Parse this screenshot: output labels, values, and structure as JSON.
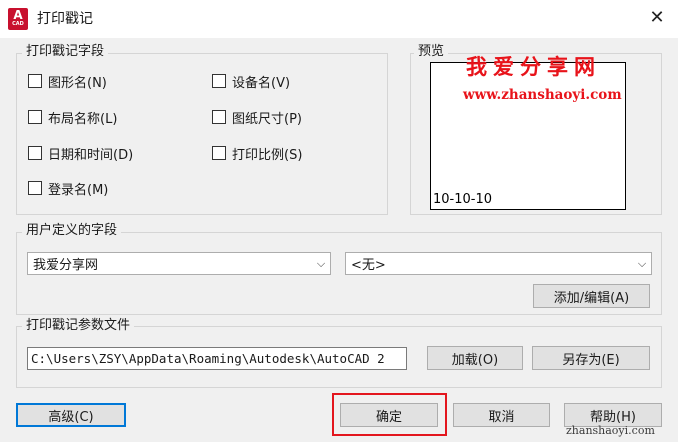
{
  "window": {
    "title": "打印戳记",
    "icon_letter": "A",
    "icon_sub": "CAD"
  },
  "stamp_fields": {
    "group_label": "打印戳记字段",
    "items": [
      {
        "label": "图形名(N)",
        "checked": false
      },
      {
        "label": "设备名(V)",
        "checked": false
      },
      {
        "label": "布局名称(L)",
        "checked": false
      },
      {
        "label": "图纸尺寸(P)",
        "checked": false
      },
      {
        "label": "日期和时间(D)",
        "checked": false
      },
      {
        "label": "打印比例(S)",
        "checked": false
      },
      {
        "label": "登录名(M)",
        "checked": false
      }
    ]
  },
  "preview": {
    "group_label": "预览",
    "stamp_text": "10-10-10"
  },
  "user_fields": {
    "group_label": "用户定义的字段",
    "select1_value": "我爱分享网",
    "select2_value": "<无>",
    "add_edit_label": "添加/编辑(A)"
  },
  "param_file": {
    "group_label": "打印戳记参数文件",
    "path_value": "C:\\Users\\ZSY\\AppData\\Roaming\\Autodesk\\AutoCAD 2",
    "load_label": "加载(O)",
    "save_as_label": "另存为(E)"
  },
  "footer": {
    "advanced_label": "高级(C)",
    "ok_label": "确定",
    "cancel_label": "取消",
    "help_label": "帮助(H)"
  },
  "watermark": {
    "site_name": "我爱分享网",
    "site_url": "www.zhanshaoyi.com",
    "corner_url": "zhanshaoyi.com"
  },
  "colors": {
    "accent_blue": "#0078d7",
    "watermark_red": "#e8131a",
    "highlight_red": "#e3161e",
    "app_icon_red": "#c8102e"
  },
  "icons": [
    "autocad-app-icon",
    "close-icon",
    "chevron-down-icon"
  ]
}
